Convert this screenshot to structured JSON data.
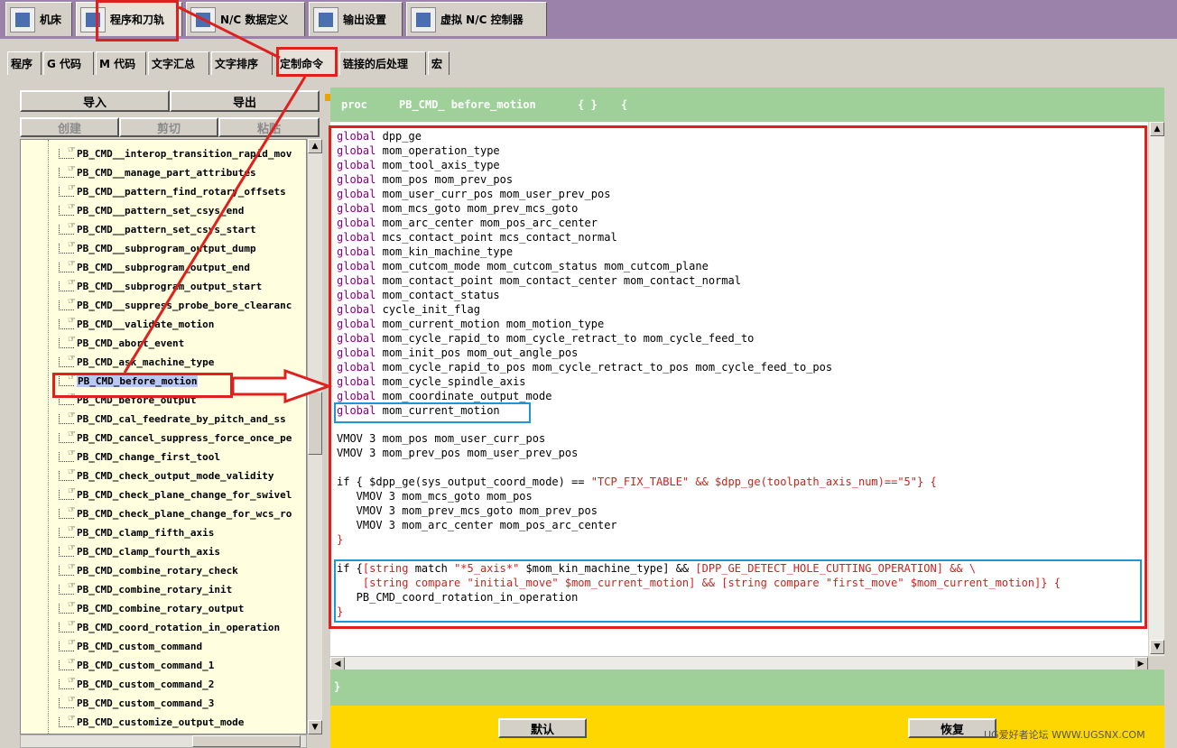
{
  "top_tabs": [
    {
      "label": "机床",
      "icon": "machine-icon"
    },
    {
      "label": "程序和刀轨",
      "icon": "program-icon"
    },
    {
      "label": "N/C 数据定义",
      "icon": "nc-data-icon"
    },
    {
      "label": "输出设置",
      "icon": "printer-icon"
    },
    {
      "label": "虚拟 N/C 控制器",
      "icon": "controller-icon"
    }
  ],
  "sub_tabs": [
    "程序",
    "G 代码",
    "M 代码",
    "文字汇总",
    "文字排序",
    "定制命令",
    "链接的后处理",
    "宏"
  ],
  "left": {
    "import_label": "导入",
    "export_label": "导出",
    "create_label": "创建",
    "cut_label": "剪切",
    "paste_label": "粘贴",
    "tree_items": [
      "PB_CMD__interop_transition_rapid_mov",
      "PB_CMD__manage_part_attributes",
      "PB_CMD__pattern_find_rotary_offsets",
      "PB_CMD__pattern_set_csys_end",
      "PB_CMD__pattern_set_csys_start",
      "PB_CMD__subprogram_output_dump",
      "PB_CMD__subprogram_output_end",
      "PB_CMD__subprogram_output_start",
      "PB_CMD__suppress_probe_bore_clearanc",
      "PB_CMD__validate_motion",
      "PB_CMD_abort_event",
      "PB_CMD_ask_machine_type",
      "PB_CMD_before_motion",
      "PB_CMD_before_output",
      "PB_CMD_cal_feedrate_by_pitch_and_ss",
      "PB_CMD_cancel_suppress_force_once_pe",
      "PB_CMD_change_first_tool",
      "PB_CMD_check_output_mode_validity",
      "PB_CMD_check_plane_change_for_swivel",
      "PB_CMD_check_plane_change_for_wcs_ro",
      "PB_CMD_clamp_fifth_axis",
      "PB_CMD_clamp_fourth_axis",
      "PB_CMD_combine_rotary_check",
      "PB_CMD_combine_rotary_init",
      "PB_CMD_combine_rotary_output",
      "PB_CMD_coord_rotation_in_operation",
      "PB_CMD_custom_command",
      "PB_CMD_custom_command_1",
      "PB_CMD_custom_command_2",
      "PB_CMD_custom_command_3",
      "PB_CMD_customize_output_mode"
    ],
    "selected_item": "PB_CMD_before_motion"
  },
  "proc": {
    "keyword": "proc",
    "name": "PB_CMD_ before_motion",
    "args": "{ }",
    "brace": "{"
  },
  "code": {
    "globals": [
      "dpp_ge",
      "mom_operation_type",
      "mom_tool_axis_type",
      "mom_pos mom_prev_pos",
      "mom_user_curr_pos mom_user_prev_pos",
      "mom_mcs_goto mom_prev_mcs_goto",
      "mom_arc_center mom_pos_arc_center",
      "mcs_contact_point mcs_contact_normal",
      "mom_kin_machine_type",
      "mom_cutcom_mode mom_cutcom_status mom_cutcom_plane",
      "mom_contact_point mom_contact_center mom_contact_normal",
      "mom_contact_status",
      "cycle_init_flag",
      "mom_current_motion mom_motion_type",
      "mom_cycle_rapid_to mom_cycle_retract_to mom_cycle_feed_to",
      "mom_init_pos mom_out_angle_pos",
      "mom_cycle_rapid_to_pos mom_cycle_retract_to_pos mom_cycle_feed_to_pos",
      "mom_cycle_spindle_axis",
      "mom_coordinate_output_mode",
      "mom_current_motion"
    ],
    "global_kw": "global",
    "vmov1": "VMOV 3 mom_pos mom_user_curr_pos",
    "vmov2": "VMOV 3 mom_prev_pos mom_user_prev_pos",
    "if1_a": "if { $dpp_ge(sys_output_coord_mode) == ",
    "if1_b": "\"TCP_FIX_TABLE\" && $dpp_ge(toolpath_axis_num)==\"5\"} {",
    "if1_body": [
      "   VMOV 3 mom_mcs_goto mom_pos",
      "   VMOV 3 mom_prev_mcs_goto mom_prev_pos",
      "   VMOV 3 mom_arc_center mom_pos_arc_center"
    ],
    "close": "}",
    "if2_l1_a": "if {",
    "if2_l1_b": "[string",
    "if2_l1_c": " match ",
    "if2_l1_d": "\"*5_axis*\"",
    "if2_l1_e": " $mom_kin_machine_type] && ",
    "if2_l1_f": "[DPP_GE_DETECT_HOLE_CUTTING_OPERATION] && \\",
    "if2_l2": "    [string compare \"initial_move\" $mom_current_motion] && [string compare \"first_move\" $mom_current_motion]} {",
    "if2_l3": "   PB_CMD_coord_rotation_in_operation"
  },
  "end_brace": "}",
  "buttons": {
    "default": "默认",
    "restore": "恢复"
  },
  "watermark": "UG爱好者论坛 WWW.UGSNX.COM",
  "colors": {
    "accent_red": "#e0201c",
    "accent_blue": "#1e96d4",
    "proc_bar": "#9fd09a",
    "bottom_bar": "#ffd700",
    "tab_strip": "#9b82aa"
  }
}
